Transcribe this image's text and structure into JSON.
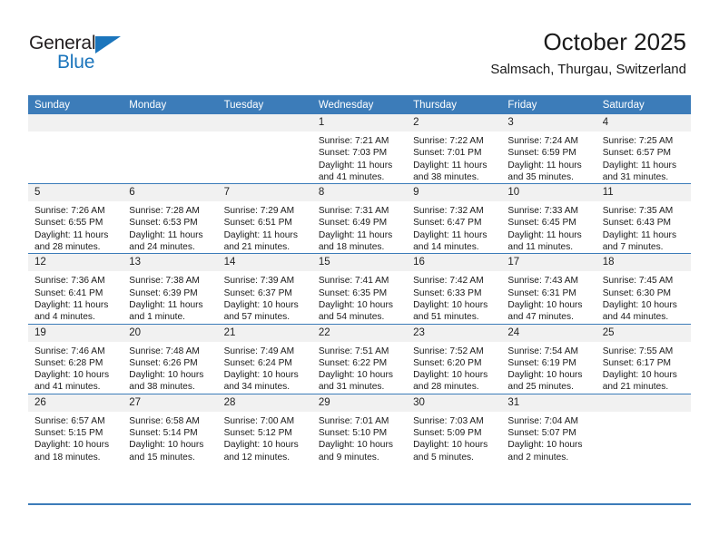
{
  "logo": {
    "line1": "General",
    "line2": "Blue",
    "accent_color": "#1b75bc"
  },
  "header": {
    "title": "October 2025",
    "subtitle": "Salmsach, Thurgau, Switzerland",
    "header_bg_color": "#3c7cb9",
    "daynum_bg_color": "#f1f1f1"
  },
  "weekdays": [
    "Sunday",
    "Monday",
    "Tuesday",
    "Wednesday",
    "Thursday",
    "Friday",
    "Saturday"
  ],
  "weeks": [
    [
      {
        "day": "",
        "blank": true,
        "sunrise": "",
        "sunset": "",
        "daylight1": "",
        "daylight2": ""
      },
      {
        "day": "",
        "blank": true,
        "sunrise": "",
        "sunset": "",
        "daylight1": "",
        "daylight2": ""
      },
      {
        "day": "",
        "blank": true,
        "sunrise": "",
        "sunset": "",
        "daylight1": "",
        "daylight2": ""
      },
      {
        "day": "1",
        "blank": false,
        "sunrise": "Sunrise: 7:21 AM",
        "sunset": "Sunset: 7:03 PM",
        "daylight1": "Daylight: 11 hours",
        "daylight2": "and 41 minutes."
      },
      {
        "day": "2",
        "blank": false,
        "sunrise": "Sunrise: 7:22 AM",
        "sunset": "Sunset: 7:01 PM",
        "daylight1": "Daylight: 11 hours",
        "daylight2": "and 38 minutes."
      },
      {
        "day": "3",
        "blank": false,
        "sunrise": "Sunrise: 7:24 AM",
        "sunset": "Sunset: 6:59 PM",
        "daylight1": "Daylight: 11 hours",
        "daylight2": "and 35 minutes."
      },
      {
        "day": "4",
        "blank": false,
        "sunrise": "Sunrise: 7:25 AM",
        "sunset": "Sunset: 6:57 PM",
        "daylight1": "Daylight: 11 hours",
        "daylight2": "and 31 minutes."
      }
    ],
    [
      {
        "day": "5",
        "blank": false,
        "sunrise": "Sunrise: 7:26 AM",
        "sunset": "Sunset: 6:55 PM",
        "daylight1": "Daylight: 11 hours",
        "daylight2": "and 28 minutes."
      },
      {
        "day": "6",
        "blank": false,
        "sunrise": "Sunrise: 7:28 AM",
        "sunset": "Sunset: 6:53 PM",
        "daylight1": "Daylight: 11 hours",
        "daylight2": "and 24 minutes."
      },
      {
        "day": "7",
        "blank": false,
        "sunrise": "Sunrise: 7:29 AM",
        "sunset": "Sunset: 6:51 PM",
        "daylight1": "Daylight: 11 hours",
        "daylight2": "and 21 minutes."
      },
      {
        "day": "8",
        "blank": false,
        "sunrise": "Sunrise: 7:31 AM",
        "sunset": "Sunset: 6:49 PM",
        "daylight1": "Daylight: 11 hours",
        "daylight2": "and 18 minutes."
      },
      {
        "day": "9",
        "blank": false,
        "sunrise": "Sunrise: 7:32 AM",
        "sunset": "Sunset: 6:47 PM",
        "daylight1": "Daylight: 11 hours",
        "daylight2": "and 14 minutes."
      },
      {
        "day": "10",
        "blank": false,
        "sunrise": "Sunrise: 7:33 AM",
        "sunset": "Sunset: 6:45 PM",
        "daylight1": "Daylight: 11 hours",
        "daylight2": "and 11 minutes."
      },
      {
        "day": "11",
        "blank": false,
        "sunrise": "Sunrise: 7:35 AM",
        "sunset": "Sunset: 6:43 PM",
        "daylight1": "Daylight: 11 hours",
        "daylight2": "and 7 minutes."
      }
    ],
    [
      {
        "day": "12",
        "blank": false,
        "sunrise": "Sunrise: 7:36 AM",
        "sunset": "Sunset: 6:41 PM",
        "daylight1": "Daylight: 11 hours",
        "daylight2": "and 4 minutes."
      },
      {
        "day": "13",
        "blank": false,
        "sunrise": "Sunrise: 7:38 AM",
        "sunset": "Sunset: 6:39 PM",
        "daylight1": "Daylight: 11 hours",
        "daylight2": "and 1 minute."
      },
      {
        "day": "14",
        "blank": false,
        "sunrise": "Sunrise: 7:39 AM",
        "sunset": "Sunset: 6:37 PM",
        "daylight1": "Daylight: 10 hours",
        "daylight2": "and 57 minutes."
      },
      {
        "day": "15",
        "blank": false,
        "sunrise": "Sunrise: 7:41 AM",
        "sunset": "Sunset: 6:35 PM",
        "daylight1": "Daylight: 10 hours",
        "daylight2": "and 54 minutes."
      },
      {
        "day": "16",
        "blank": false,
        "sunrise": "Sunrise: 7:42 AM",
        "sunset": "Sunset: 6:33 PM",
        "daylight1": "Daylight: 10 hours",
        "daylight2": "and 51 minutes."
      },
      {
        "day": "17",
        "blank": false,
        "sunrise": "Sunrise: 7:43 AM",
        "sunset": "Sunset: 6:31 PM",
        "daylight1": "Daylight: 10 hours",
        "daylight2": "and 47 minutes."
      },
      {
        "day": "18",
        "blank": false,
        "sunrise": "Sunrise: 7:45 AM",
        "sunset": "Sunset: 6:30 PM",
        "daylight1": "Daylight: 10 hours",
        "daylight2": "and 44 minutes."
      }
    ],
    [
      {
        "day": "19",
        "blank": false,
        "sunrise": "Sunrise: 7:46 AM",
        "sunset": "Sunset: 6:28 PM",
        "daylight1": "Daylight: 10 hours",
        "daylight2": "and 41 minutes."
      },
      {
        "day": "20",
        "blank": false,
        "sunrise": "Sunrise: 7:48 AM",
        "sunset": "Sunset: 6:26 PM",
        "daylight1": "Daylight: 10 hours",
        "daylight2": "and 38 minutes."
      },
      {
        "day": "21",
        "blank": false,
        "sunrise": "Sunrise: 7:49 AM",
        "sunset": "Sunset: 6:24 PM",
        "daylight1": "Daylight: 10 hours",
        "daylight2": "and 34 minutes."
      },
      {
        "day": "22",
        "blank": false,
        "sunrise": "Sunrise: 7:51 AM",
        "sunset": "Sunset: 6:22 PM",
        "daylight1": "Daylight: 10 hours",
        "daylight2": "and 31 minutes."
      },
      {
        "day": "23",
        "blank": false,
        "sunrise": "Sunrise: 7:52 AM",
        "sunset": "Sunset: 6:20 PM",
        "daylight1": "Daylight: 10 hours",
        "daylight2": "and 28 minutes."
      },
      {
        "day": "24",
        "blank": false,
        "sunrise": "Sunrise: 7:54 AM",
        "sunset": "Sunset: 6:19 PM",
        "daylight1": "Daylight: 10 hours",
        "daylight2": "and 25 minutes."
      },
      {
        "day": "25",
        "blank": false,
        "sunrise": "Sunrise: 7:55 AM",
        "sunset": "Sunset: 6:17 PM",
        "daylight1": "Daylight: 10 hours",
        "daylight2": "and 21 minutes."
      }
    ],
    [
      {
        "day": "26",
        "blank": false,
        "sunrise": "Sunrise: 6:57 AM",
        "sunset": "Sunset: 5:15 PM",
        "daylight1": "Daylight: 10 hours",
        "daylight2": "and 18 minutes."
      },
      {
        "day": "27",
        "blank": false,
        "sunrise": "Sunrise: 6:58 AM",
        "sunset": "Sunset: 5:14 PM",
        "daylight1": "Daylight: 10 hours",
        "daylight2": "and 15 minutes."
      },
      {
        "day": "28",
        "blank": false,
        "sunrise": "Sunrise: 7:00 AM",
        "sunset": "Sunset: 5:12 PM",
        "daylight1": "Daylight: 10 hours",
        "daylight2": "and 12 minutes."
      },
      {
        "day": "29",
        "blank": false,
        "sunrise": "Sunrise: 7:01 AM",
        "sunset": "Sunset: 5:10 PM",
        "daylight1": "Daylight: 10 hours",
        "daylight2": "and 9 minutes."
      },
      {
        "day": "30",
        "blank": false,
        "sunrise": "Sunrise: 7:03 AM",
        "sunset": "Sunset: 5:09 PM",
        "daylight1": "Daylight: 10 hours",
        "daylight2": "and 5 minutes."
      },
      {
        "day": "31",
        "blank": false,
        "sunrise": "Sunrise: 7:04 AM",
        "sunset": "Sunset: 5:07 PM",
        "daylight1": "Daylight: 10 hours",
        "daylight2": "and 2 minutes."
      },
      {
        "day": "",
        "blank": true,
        "sunrise": "",
        "sunset": "",
        "daylight1": "",
        "daylight2": ""
      }
    ]
  ]
}
